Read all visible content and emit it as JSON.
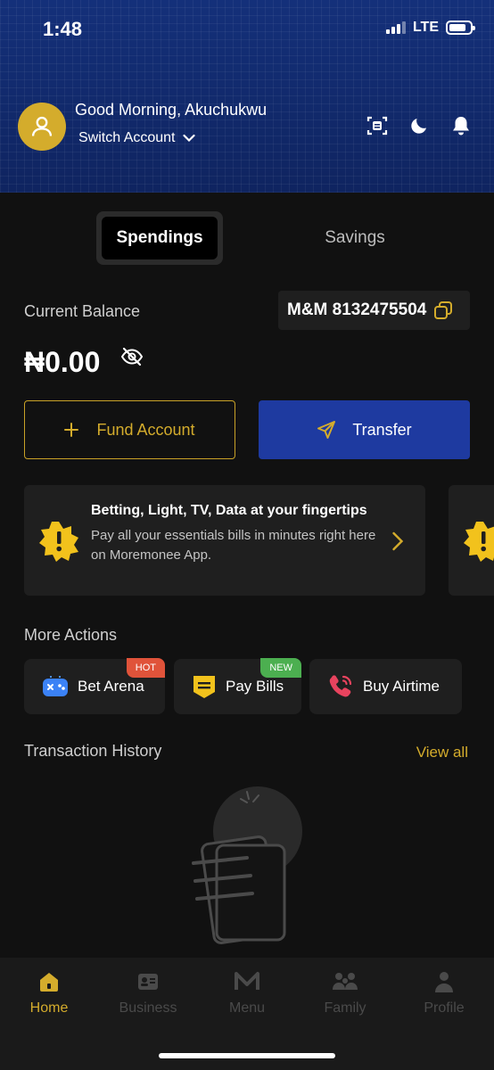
{
  "status": {
    "time": "1:48",
    "network": "LTE",
    "battery_level": 0.8
  },
  "header": {
    "greeting": "Good Morning,  Akuchukwu",
    "switch_account": "Switch Account",
    "icons": [
      "scan-icon",
      "moon-icon",
      "bell-icon"
    ]
  },
  "tabs": {
    "active": "Spendings",
    "inactive": "Savings"
  },
  "balance": {
    "label": "Current Balance",
    "account_chip": "M&M 8132475504",
    "amount": "₦0.00"
  },
  "buttons": {
    "fund": "Fund Account",
    "transfer": "Transfer"
  },
  "promo": {
    "title": "Betting, Light, TV, Data at your fingertips",
    "body": "Pay all your essentials bills in minutes right here on Moremonee App."
  },
  "more_actions": {
    "title": "More Actions",
    "items": [
      {
        "label": "Bet Arena",
        "badge": "HOT",
        "badge_color": "#e0533a"
      },
      {
        "label": "Pay Bills",
        "badge": "NEW",
        "badge_color": "#4caf50"
      },
      {
        "label": "Buy Airtime",
        "badge": "",
        "badge_color": ""
      }
    ]
  },
  "transactions": {
    "title": "Transaction History",
    "view_all": "View all"
  },
  "nav": {
    "items": [
      {
        "label": "Home",
        "active": true
      },
      {
        "label": "Business",
        "active": false
      },
      {
        "label": "Menu",
        "active": false
      },
      {
        "label": "Family",
        "active": false
      },
      {
        "label": "Profile",
        "active": false
      }
    ]
  },
  "colors": {
    "accent": "#d4ac2c",
    "primary": "#1e3aa0",
    "header_bg": "#132a6e",
    "background": "#111111"
  }
}
